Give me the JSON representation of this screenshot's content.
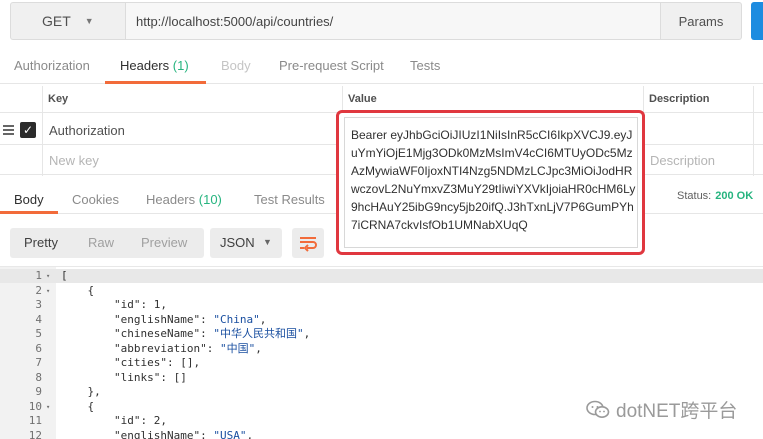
{
  "request": {
    "method": "GET",
    "url": "http://localhost:5000/api/countries/",
    "params_label": "Params"
  },
  "request_tabs": {
    "authorization": "Authorization",
    "headers": "Headers",
    "headers_count": "(1)",
    "body": "Body",
    "prerequest": "Pre-request Script",
    "tests": "Tests"
  },
  "headers_table": {
    "col_key": "Key",
    "col_value": "Value",
    "col_description": "Description",
    "row1_key": "Authorization",
    "new_key_placeholder": "New key",
    "description_placeholder": "Description",
    "row1_checked": true
  },
  "value_popover": {
    "text": "Bearer eyJhbGciOiJIUzI1NiIsInR5cCI6IkpXVCJ9.eyJuYmYiOjE1Mjg3ODk0MzMsImV4cCI6MTUyODc5MzAzMywiaWF0IjoxNTI4Nzg5NDMzLCJpc3MiOiJodHRwczovL2NuYmxvZ3MuY29tIiwiYXVkIjoiaHR0cHM6Ly9hcHAuY25ibG9ncy5jb20ifQ.J3hTxnLjV7P6GumPYh7iCRNA7ckvIsfOb1UMNabXUqQ"
  },
  "response_tabs": {
    "body": "Body",
    "cookies": "Cookies",
    "headers": "Headers",
    "headers_count": "(10)",
    "test_results": "Test Results"
  },
  "status": {
    "label": "Status:",
    "value": "200 OK"
  },
  "response_toolbar": {
    "pretty": "Pretty",
    "raw": "Raw",
    "preview": "Preview",
    "format": "JSON"
  },
  "code_lines": [
    {
      "n": "1",
      "fold": "▾",
      "text": "["
    },
    {
      "n": "2",
      "fold": "▾",
      "text": "    {"
    },
    {
      "n": "3",
      "fold": "",
      "text": "        \"id\": 1,"
    },
    {
      "n": "4",
      "fold": "",
      "text": "        \"englishName\": \"China\","
    },
    {
      "n": "5",
      "fold": "",
      "text": "        \"chineseName\": \"中华人民共和国\","
    },
    {
      "n": "6",
      "fold": "",
      "text": "        \"abbreviation\": \"中国\","
    },
    {
      "n": "7",
      "fold": "",
      "text": "        \"cities\": [],"
    },
    {
      "n": "8",
      "fold": "",
      "text": "        \"links\": []"
    },
    {
      "n": "9",
      "fold": "",
      "text": "    },"
    },
    {
      "n": "10",
      "fold": "▾",
      "text": "    {"
    },
    {
      "n": "11",
      "fold": "",
      "text": "        \"id\": 2,"
    },
    {
      "n": "12",
      "fold": "",
      "text": "        \"englishName\": \"USA\","
    }
  ],
  "watermark": "dotNET跨平台",
  "colors": {
    "accent": "#f26b3a",
    "highlight_box": "#e0373f",
    "status_ok": "#26b47f",
    "send": "#1d8ce0"
  }
}
